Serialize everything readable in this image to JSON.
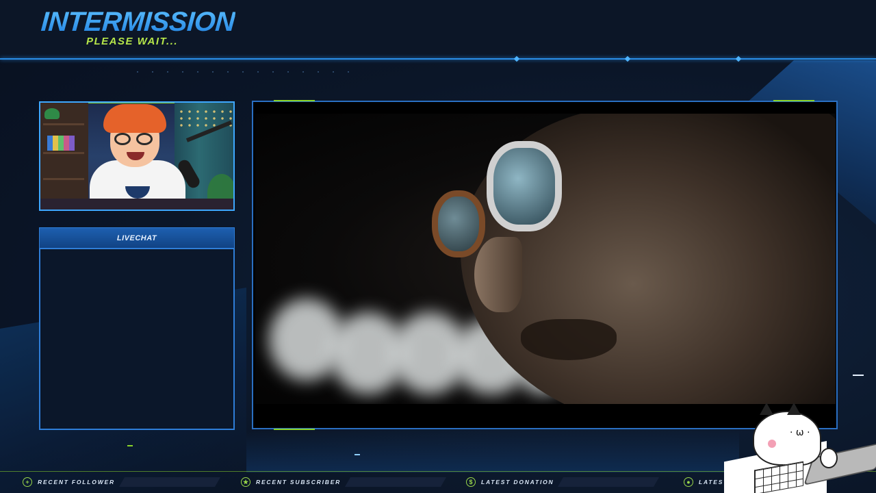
{
  "header": {
    "title": "INTERMISSION",
    "subtitle": "PLEASE WAIT..."
  },
  "chat": {
    "label": "LIVECHAT"
  },
  "bottom_bar": {
    "items": [
      {
        "label": "RECENT FOLLOWER",
        "icon": "plus-icon",
        "glyph": "+"
      },
      {
        "label": "RECENT SUBSCRIBER",
        "icon": "star-icon",
        "glyph": "★"
      },
      {
        "label": "LATEST DONATION",
        "icon": "dollar-icon",
        "glyph": "$"
      },
      {
        "label": "LATEST",
        "icon": "drop-icon",
        "glyph": "●"
      }
    ]
  },
  "colors": {
    "accent_blue": "#2a8ee8",
    "accent_green": "#8ad42a",
    "background": "#0a1220"
  }
}
